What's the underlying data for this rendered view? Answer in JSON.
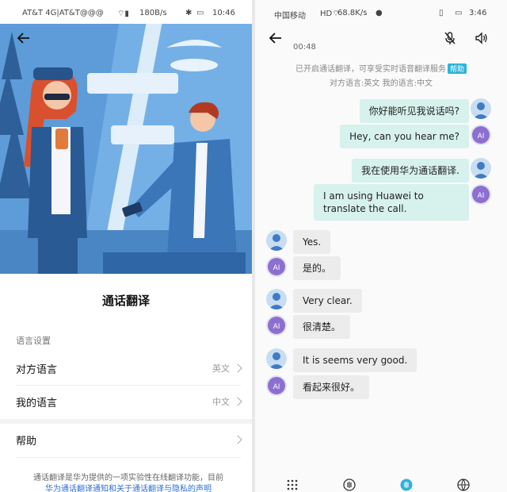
{
  "left": {
    "status": {
      "carrier": "AT&T 4G|AT&T@@@",
      "net_speed": "180B/s",
      "time": "10:46"
    },
    "title": "通话翻译",
    "section_label": "语言设置",
    "rows": [
      {
        "label": "对方语言",
        "value": "英文"
      },
      {
        "label": "我的语言",
        "value": "中文"
      },
      {
        "label": "帮助",
        "value": ""
      }
    ],
    "footnote": {
      "line1": "通话翻译是华为提供的一项实验性在线翻译功能，目前",
      "line2": "华为通话翻译通知和关于通话翻译与隐私的声明"
    }
  },
  "right": {
    "status": {
      "carrier": "中国移动",
      "net_speed": "68.8K/s",
      "time": "3:46"
    },
    "timer": "00:48",
    "info": {
      "line1": "已开启通话翻译，可享受实时语音翻译服务",
      "help": "帮助",
      "line2": "对方语言:英文 我的语言:中文"
    },
    "messages": [
      {
        "side": "me",
        "type": "person",
        "text": "你好能听见我说话吗?"
      },
      {
        "side": "me",
        "type": "ai",
        "ai_label": "AI",
        "text": "Hey, can you hear me?"
      },
      {
        "side": "me",
        "type": "person",
        "text": "我在使用华为通话翻译."
      },
      {
        "side": "me",
        "type": "ai",
        "ai_label": "AI",
        "text": "I am using Huawei to translate the call."
      },
      {
        "side": "them",
        "type": "person",
        "text": "Yes."
      },
      {
        "side": "them",
        "type": "ai",
        "ai_label": "AI",
        "text": "是的。"
      },
      {
        "side": "them",
        "type": "person",
        "text": "Very clear."
      },
      {
        "side": "them",
        "type": "ai",
        "ai_label": "AI",
        "text": "很清楚。"
      },
      {
        "side": "them",
        "type": "person",
        "text": "It is seems very good."
      },
      {
        "side": "them",
        "type": "ai",
        "ai_label": "AI",
        "text": "看起来很好。"
      }
    ]
  },
  "colors": {
    "accent": "#2db3d9",
    "bubble_me": "#d7f1ec",
    "bubble_them": "#ececec",
    "hero_bg": "#5a9ad6"
  }
}
